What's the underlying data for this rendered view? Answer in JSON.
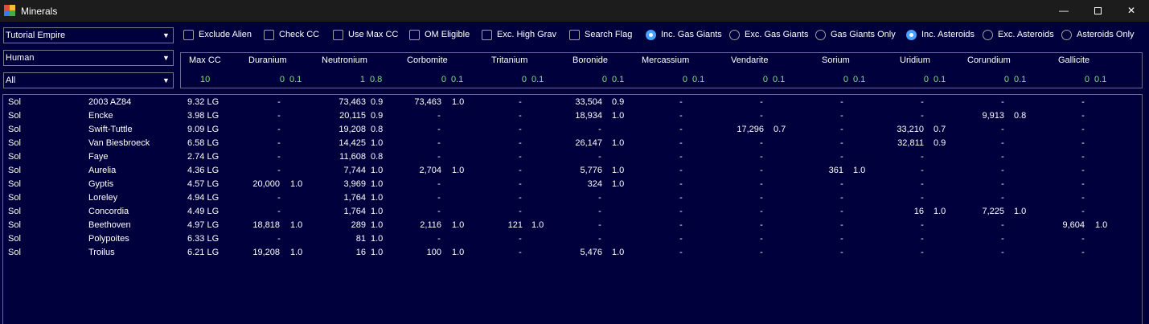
{
  "window": {
    "title": "Minerals",
    "minimize": "—",
    "close": "✕"
  },
  "combos": {
    "empire": "Tutorial Empire",
    "race": "Human",
    "filter": "All"
  },
  "checkboxes": [
    "Exclude Alien",
    "Check CC",
    "Use Max CC",
    "OM Eligible",
    "Exc. High Grav",
    "Search Flag"
  ],
  "gas_radios": [
    "Inc. Gas Giants",
    "Exc. Gas Giants",
    "Gas Giants Only"
  ],
  "asteroid_radios": [
    "Inc. Asteroids",
    "Exc. Asteroids",
    "Asteroids Only"
  ],
  "header": {
    "maxcc_label": "Max CC",
    "maxcc_value": "10",
    "minerals": [
      {
        "name": "Duranium",
        "amount": "0",
        "acc": "0.1"
      },
      {
        "name": "Neutronium",
        "amount": "1",
        "acc": "0.8"
      },
      {
        "name": "Corbomite",
        "amount": "0",
        "acc": "0.1"
      },
      {
        "name": "Tritanium",
        "amount": "0",
        "acc": "0.1"
      },
      {
        "name": "Boronide",
        "amount": "0",
        "acc": "0.1"
      },
      {
        "name": "Mercassium",
        "amount": "0",
        "acc": "0.1"
      },
      {
        "name": "Vendarite",
        "amount": "0",
        "acc": "0.1"
      },
      {
        "name": "Sorium",
        "amount": "0",
        "acc": "0.1"
      },
      {
        "name": "Uridium",
        "amount": "0",
        "acc": "0.1"
      },
      {
        "name": "Corundium",
        "amount": "0",
        "acc": "0.1"
      },
      {
        "name": "Gallicite",
        "amount": "0",
        "acc": "0.1"
      }
    ]
  },
  "rows": [
    {
      "system": "Sol",
      "body": "2003 AZ84",
      "cc": "9.32 LG",
      "m": [
        [
          "-",
          ""
        ],
        [
          "73,463",
          "0.9"
        ],
        [
          "73,463",
          "1.0"
        ],
        [
          "-",
          ""
        ],
        [
          "33,504",
          "0.9"
        ],
        [
          "-",
          ""
        ],
        [
          "-",
          ""
        ],
        [
          "-",
          ""
        ],
        [
          "-",
          ""
        ],
        [
          "-",
          ""
        ],
        [
          "-",
          ""
        ]
      ]
    },
    {
      "system": "Sol",
      "body": "Encke",
      "cc": "3.98 LG",
      "m": [
        [
          "-",
          ""
        ],
        [
          "20,115",
          "0.9"
        ],
        [
          "-",
          ""
        ],
        [
          "-",
          ""
        ],
        [
          "18,934",
          "1.0"
        ],
        [
          "-",
          ""
        ],
        [
          "-",
          ""
        ],
        [
          "-",
          ""
        ],
        [
          "-",
          ""
        ],
        [
          "9,913",
          "0.8"
        ],
        [
          "-",
          ""
        ]
      ]
    },
    {
      "system": "Sol",
      "body": "Swift-Tuttle",
      "cc": "9.09 LG",
      "m": [
        [
          "-",
          ""
        ],
        [
          "19,208",
          "0.8"
        ],
        [
          "-",
          ""
        ],
        [
          "-",
          ""
        ],
        [
          "-",
          ""
        ],
        [
          "-",
          ""
        ],
        [
          "17,296",
          "0.7"
        ],
        [
          "-",
          ""
        ],
        [
          "33,210",
          "0.7"
        ],
        [
          "-",
          ""
        ],
        [
          "-",
          ""
        ]
      ]
    },
    {
      "system": "Sol",
      "body": "Van Biesbroeck",
      "cc": "6.58 LG",
      "m": [
        [
          "-",
          ""
        ],
        [
          "14,425",
          "1.0"
        ],
        [
          "-",
          ""
        ],
        [
          "-",
          ""
        ],
        [
          "26,147",
          "1.0"
        ],
        [
          "-",
          ""
        ],
        [
          "-",
          ""
        ],
        [
          "-",
          ""
        ],
        [
          "32,811",
          "0.9"
        ],
        [
          "-",
          ""
        ],
        [
          "-",
          ""
        ]
      ]
    },
    {
      "system": "Sol",
      "body": "Faye",
      "cc": "2.74 LG",
      "m": [
        [
          "-",
          ""
        ],
        [
          "11,608",
          "0.8"
        ],
        [
          "-",
          ""
        ],
        [
          "-",
          ""
        ],
        [
          "-",
          ""
        ],
        [
          "-",
          ""
        ],
        [
          "-",
          ""
        ],
        [
          "-",
          ""
        ],
        [
          "-",
          ""
        ],
        [
          "-",
          ""
        ],
        [
          "-",
          ""
        ]
      ]
    },
    {
      "system": "Sol",
      "body": "Aurelia",
      "cc": "4.36 LG",
      "m": [
        [
          "-",
          ""
        ],
        [
          "7,744",
          "1.0"
        ],
        [
          "2,704",
          "1.0"
        ],
        [
          "-",
          ""
        ],
        [
          "5,776",
          "1.0"
        ],
        [
          "-",
          ""
        ],
        [
          "-",
          ""
        ],
        [
          "361",
          "1.0"
        ],
        [
          "-",
          ""
        ],
        [
          "-",
          ""
        ],
        [
          "-",
          ""
        ]
      ]
    },
    {
      "system": "Sol",
      "body": "Gyptis",
      "cc": "4.57 LG",
      "m": [
        [
          "20,000",
          "1.0"
        ],
        [
          "3,969",
          "1.0"
        ],
        [
          "-",
          ""
        ],
        [
          "-",
          ""
        ],
        [
          "324",
          "1.0"
        ],
        [
          "-",
          ""
        ],
        [
          "-",
          ""
        ],
        [
          "-",
          ""
        ],
        [
          "-",
          ""
        ],
        [
          "-",
          ""
        ],
        [
          "-",
          ""
        ]
      ]
    },
    {
      "system": "Sol",
      "body": "Loreley",
      "cc": "4.94 LG",
      "m": [
        [
          "-",
          ""
        ],
        [
          "1,764",
          "1.0"
        ],
        [
          "-",
          ""
        ],
        [
          "-",
          ""
        ],
        [
          "-",
          ""
        ],
        [
          "-",
          ""
        ],
        [
          "-",
          ""
        ],
        [
          "-",
          ""
        ],
        [
          "-",
          ""
        ],
        [
          "-",
          ""
        ],
        [
          "-",
          ""
        ]
      ]
    },
    {
      "system": "Sol",
      "body": "Concordia",
      "cc": "4.49 LG",
      "m": [
        [
          "-",
          ""
        ],
        [
          "1,764",
          "1.0"
        ],
        [
          "-",
          ""
        ],
        [
          "-",
          ""
        ],
        [
          "-",
          ""
        ],
        [
          "-",
          ""
        ],
        [
          "-",
          ""
        ],
        [
          "-",
          ""
        ],
        [
          "16",
          "1.0"
        ],
        [
          "7,225",
          "1.0"
        ],
        [
          "-",
          ""
        ]
      ]
    },
    {
      "system": "Sol",
      "body": "Beethoven",
      "cc": "4.97 LG",
      "m": [
        [
          "18,818",
          "1.0"
        ],
        [
          "289",
          "1.0"
        ],
        [
          "2,116",
          "1.0"
        ],
        [
          "121",
          "1.0"
        ],
        [
          "-",
          ""
        ],
        [
          "-",
          ""
        ],
        [
          "-",
          ""
        ],
        [
          "-",
          ""
        ],
        [
          "-",
          ""
        ],
        [
          "-",
          ""
        ],
        [
          "9,604",
          "1.0"
        ]
      ]
    },
    {
      "system": "Sol",
      "body": "Polypoites",
      "cc": "6.33 LG",
      "m": [
        [
          "-",
          ""
        ],
        [
          "81",
          "1.0"
        ],
        [
          "-",
          ""
        ],
        [
          "-",
          ""
        ],
        [
          "-",
          ""
        ],
        [
          "-",
          ""
        ],
        [
          "-",
          ""
        ],
        [
          "-",
          ""
        ],
        [
          "-",
          ""
        ],
        [
          "-",
          ""
        ],
        [
          "-",
          ""
        ]
      ]
    },
    {
      "system": "Sol",
      "body": "Troilus",
      "cc": "6.21 LG",
      "m": [
        [
          "19,208",
          "1.0"
        ],
        [
          "16",
          "1.0"
        ],
        [
          "100",
          "1.0"
        ],
        [
          "-",
          ""
        ],
        [
          "5,476",
          "1.0"
        ],
        [
          "-",
          ""
        ],
        [
          "-",
          ""
        ],
        [
          "-",
          ""
        ],
        [
          "-",
          ""
        ],
        [
          "-",
          ""
        ],
        [
          "-",
          ""
        ]
      ]
    }
  ]
}
